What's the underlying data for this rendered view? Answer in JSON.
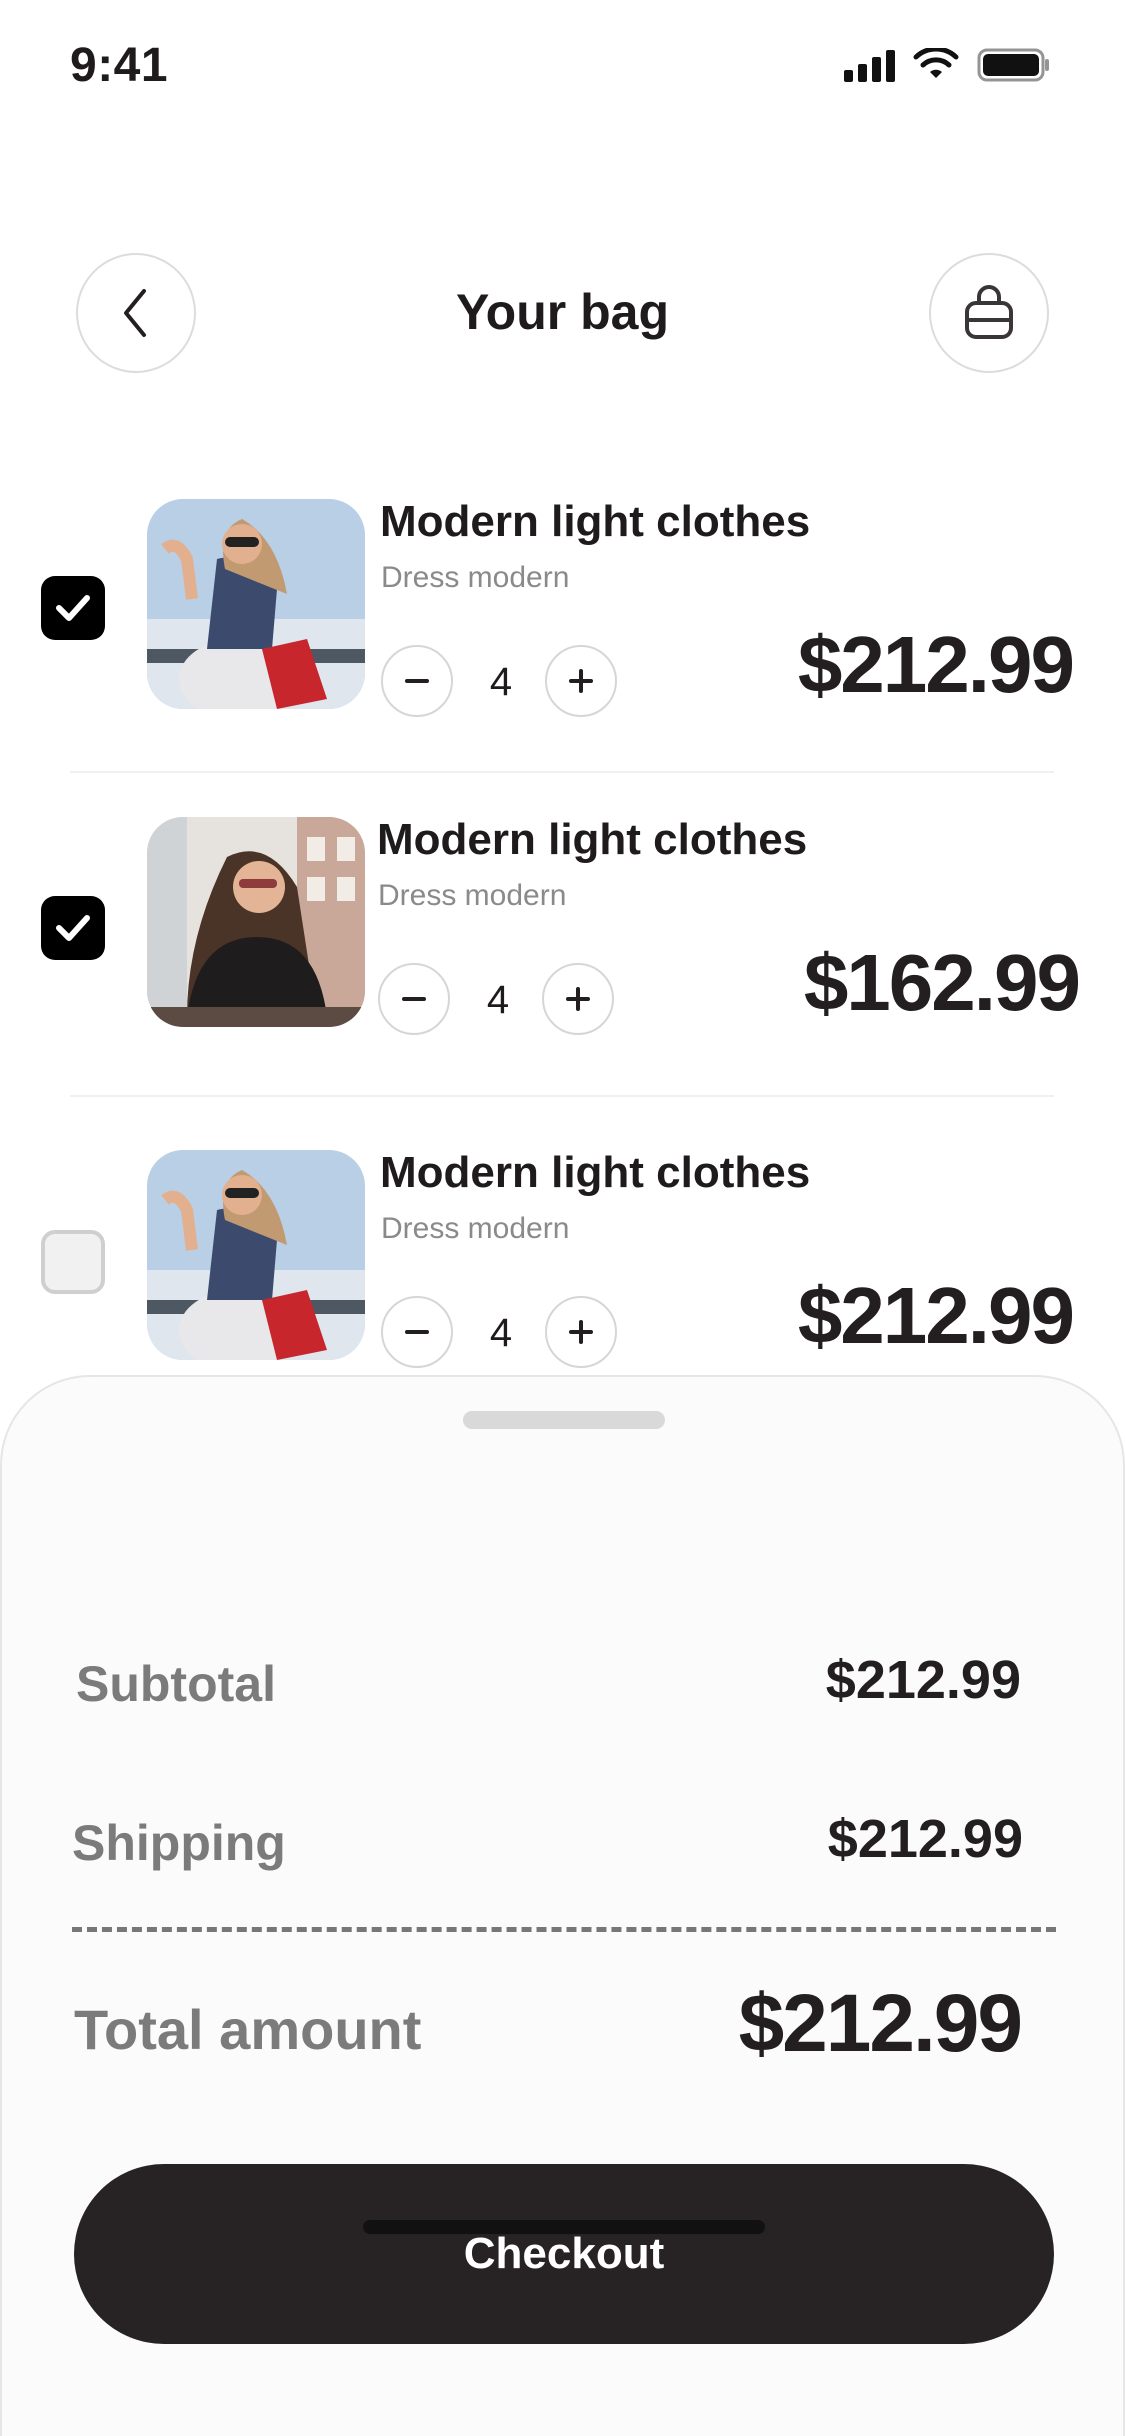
{
  "status_bar": {
    "time": "9:41"
  },
  "header": {
    "title": "Your bag"
  },
  "items": [
    {
      "name": "Modern light clothes",
      "subtitle": "Dress modern",
      "quantity": "4",
      "price": "$212.99",
      "checked": true
    },
    {
      "name": "Modern light clothes",
      "subtitle": "Dress modern",
      "quantity": "4",
      "price": "$162.99",
      "checked": true
    },
    {
      "name": "Modern light clothes",
      "subtitle": "Dress modern",
      "quantity": "4",
      "price": "$212.99",
      "checked": false
    }
  ],
  "summary": {
    "subtotal_label": "Subtotal",
    "subtotal_value": "$212.99",
    "shipping_label": "Shipping",
    "shipping_value": "$212.99",
    "total_label": "Total amount",
    "total_value": "$212.99"
  },
  "checkout_label": "Checkout",
  "icons": {
    "back": "chevron-left-icon",
    "bag": "shopping-bag-icon",
    "check": "check-icon",
    "minus": "minus-icon",
    "plus": "plus-icon"
  },
  "colors": {
    "primary_dark": "#272223",
    "checkbox_checked": "#000000",
    "muted_text": "#7b7b7b",
    "sheet_bg": "#fbfbfb"
  }
}
